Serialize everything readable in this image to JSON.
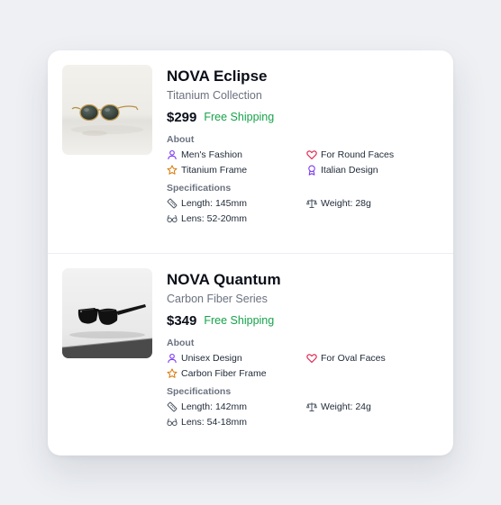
{
  "products": [
    {
      "title": "NOVA Eclipse",
      "subtitle": "Titanium Collection",
      "price": "$299",
      "shipping": "Free Shipping",
      "about_label": "About",
      "about": {
        "gender": "Men's Fashion",
        "faces": "For Round Faces",
        "frame": "Titanium Frame",
        "design": "Italian Design"
      },
      "spec_label": "Specifications",
      "specs": {
        "length": "Length: 145mm",
        "weight": "Weight: 28g",
        "lens": "Lens: 52-20mm"
      }
    },
    {
      "title": "NOVA Quantum",
      "subtitle": "Carbon Fiber Series",
      "price": "$349",
      "shipping": "Free Shipping",
      "about_label": "About",
      "about": {
        "gender": "Unisex Design",
        "faces": "For Oval Faces",
        "frame": "Carbon Fiber Frame"
      },
      "spec_label": "Specifications",
      "specs": {
        "length": "Length: 142mm",
        "weight": "Weight: 24g",
        "lens": "Lens: 54-18mm"
      }
    }
  ],
  "colors": {
    "accent_green": "#16a34a",
    "icon_purple": "#7c3aed",
    "icon_red": "#e11d48",
    "icon_amber": "#d97706",
    "icon_gray": "#4b5563"
  },
  "icons": [
    "user-icon",
    "heart-icon",
    "star-icon",
    "award-icon",
    "ruler-icon",
    "scale-icon",
    "glasses-icon"
  ]
}
